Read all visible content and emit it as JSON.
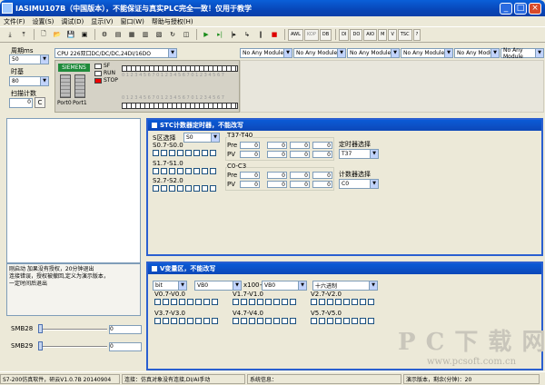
{
  "window": {
    "title": "IASIMU107B（中国版本），不能保证与真实PLC完全一致！仅用于教学"
  },
  "menu": [
    "文件(F)",
    "设置(S)",
    "调试(D)",
    "显示(V)",
    "窗口(W)",
    "帮助与授权(H)"
  ],
  "toolbar": {
    "text_buttons": [
      "AWL",
      "KOP",
      "DB",
      "DI",
      "DO",
      "AIO",
      "M",
      "V",
      "TSC",
      "?"
    ]
  },
  "left": {
    "cycle_label": "周期ms",
    "cycle_value": "50",
    "timer_label": "时基",
    "timer_value": "80",
    "scan_label": "扫描计数",
    "scan_value": "0",
    "scan_btn": "C"
  },
  "cpu": {
    "model": "CPU 226双口DC/DC/DC,24DI/16DO",
    "brand": "SIEMENS",
    "sf": "SF",
    "run": "RUN",
    "stop": "STOP",
    "port0": "Port0",
    "port1": "Port1",
    "digits": "0 1 2 3 4 5 6 7 0 1 2 3 4 5 6 7 0 1 2 3 4 5 6 7"
  },
  "modules": [
    "No Any Module",
    "No Any Module",
    "No Any Module",
    "No Any Module",
    "No Any Module",
    "No Any Module"
  ],
  "stc": {
    "title": "STC计数器定时器，不能改写",
    "sel_label": "S区选择",
    "sel_value": "S0",
    "g1": "S0.7-S0.0",
    "g2": "S1.7-S1.0",
    "g3": "S2.7-S2.0",
    "t_group": "T37-T40",
    "pre": "Pre",
    "pv": "PV",
    "c_group": "C0-C3",
    "timer_sel_label": "定时器选择",
    "timer_sel_value": "T37",
    "counter_sel_label": "计数器选择",
    "counter_sel_value": "C0",
    "zero": "0"
  },
  "vvar": {
    "title": "V变量区，不能改写",
    "type": "bit",
    "area": "VB0",
    "mult": "x100+",
    "area2": "VB0",
    "format": "十六进制",
    "groups": [
      "V0.7-V0.0",
      "V1.7-V1.0",
      "V2.7-V2.0",
      "V3.7-V3.0",
      "V4.7-V4.0",
      "V5.7-V5.0"
    ]
  },
  "notes": [
    "刚启动 加果没有授权，20分钟退出",
    "连接错误，授权被撤回,定义为演示版本，",
    "一定时间后退出"
  ],
  "smb": [
    {
      "label": "SMB28",
      "value": "0"
    },
    {
      "label": "SMB29",
      "value": "0"
    }
  ],
  "statusbar": [
    "S7-200仿真软件，研云V1.0.7B 20140904",
    "连接：仿真对象没有连接,DI/AI手动",
    "系统信息：",
    "演示版本，剩余(分钟)：20"
  ],
  "watermark": {
    "big": "P C 下 载 网",
    "url": "www.pcsoft.com.cn"
  }
}
